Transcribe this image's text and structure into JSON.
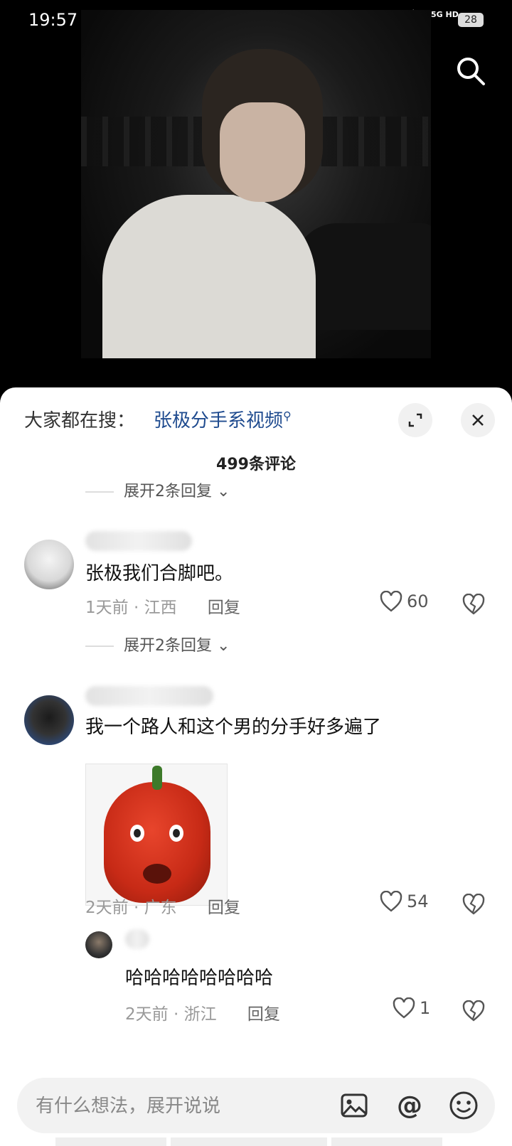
{
  "status": {
    "time": "19:57",
    "network": "5G HD",
    "battery": "28"
  },
  "search_hint": {
    "prefix": "大家都在搜：",
    "term": "张极分手系视频"
  },
  "comments_count": "499条评论",
  "expand_replies_1": "展开2条回复",
  "expand_replies_2": "展开2条回复",
  "comments": [
    {
      "text": "张极我们合脚吧。",
      "time": "1天前",
      "location": "江西",
      "reply": "回复",
      "likes": "60"
    },
    {
      "text": "我一个路人和这个男的分手好多遍了",
      "time": "2天前",
      "location": "广东",
      "reply": "回复",
      "likes": "54"
    }
  ],
  "sub_reply": {
    "text": "哈哈哈哈哈哈哈哈",
    "time": "2天前",
    "location": "浙江",
    "reply": "回复",
    "likes": "1"
  },
  "input": {
    "placeholder": "有什么想法，展开说说"
  },
  "icons": [
    "search-icon",
    "expand-icon",
    "close-icon",
    "heart-icon",
    "broken-heart-icon",
    "image-icon",
    "at-icon",
    "emoji-icon"
  ]
}
